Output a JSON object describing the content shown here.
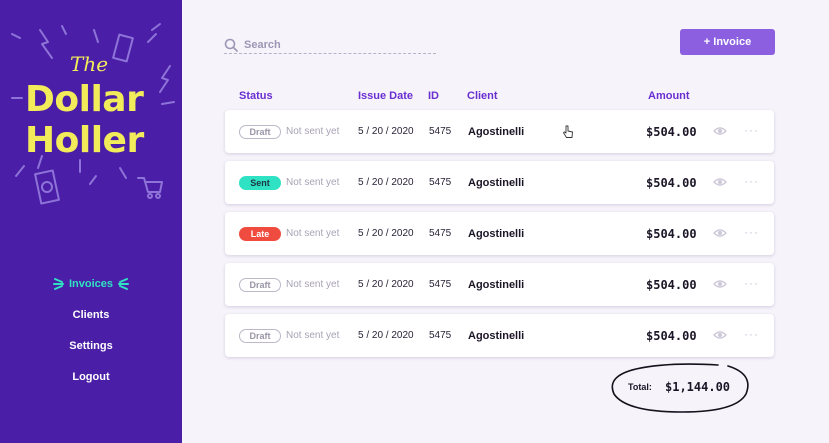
{
  "logo": {
    "the": "The",
    "line1": "Dollar",
    "line2": "Holler"
  },
  "nav": {
    "items": [
      {
        "label": "Invoices",
        "active": true
      },
      {
        "label": "Clients",
        "active": false
      },
      {
        "label": "Settings",
        "active": false
      },
      {
        "label": "Logout",
        "active": false
      }
    ]
  },
  "search": {
    "placeholder": "Search",
    "icon": "search-icon"
  },
  "toolbar": {
    "new_invoice_label": "+ Invoice"
  },
  "table": {
    "headers": {
      "status": "Status",
      "issue_date": "Issue Date",
      "id": "ID",
      "client": "Client",
      "amount": "Amount"
    },
    "rows": [
      {
        "status": "Draft",
        "status_kind": "draft",
        "note": "Not sent yet",
        "date": "5 / 20 / 2020",
        "id": "5475",
        "client": "Agostinelli",
        "amount": "$504.00"
      },
      {
        "status": "Sent",
        "status_kind": "sent",
        "note": "Not sent yet",
        "date": "5 / 20 / 2020",
        "id": "5475",
        "client": "Agostinelli",
        "amount": "$504.00"
      },
      {
        "status": "Late",
        "status_kind": "late",
        "note": "Not sent yet",
        "date": "5 / 20 / 2020",
        "id": "5475",
        "client": "Agostinelli",
        "amount": "$504.00"
      },
      {
        "status": "Draft",
        "status_kind": "draft",
        "note": "Not sent yet",
        "date": "5 / 20 / 2020",
        "id": "5475",
        "client": "Agostinelli",
        "amount": "$504.00"
      },
      {
        "status": "Draft",
        "status_kind": "draft",
        "note": "Not sent yet",
        "date": "5 / 20 / 2020",
        "id": "5475",
        "client": "Agostinelli",
        "amount": "$504.00"
      }
    ],
    "row_icons": {
      "view": "eye-icon",
      "more": "more-icon"
    },
    "more_glyph": "···"
  },
  "total": {
    "label": "Total:",
    "value": "$1,144.00"
  },
  "colors": {
    "sidebar": "#4a1ea6",
    "logo": "#f2ec5a",
    "accent": "#8c5fe0",
    "header_text": "#6a2fd0",
    "active_nav": "#2fe2c4",
    "sent": "#2fe2c4",
    "late": "#ef4b3f"
  }
}
